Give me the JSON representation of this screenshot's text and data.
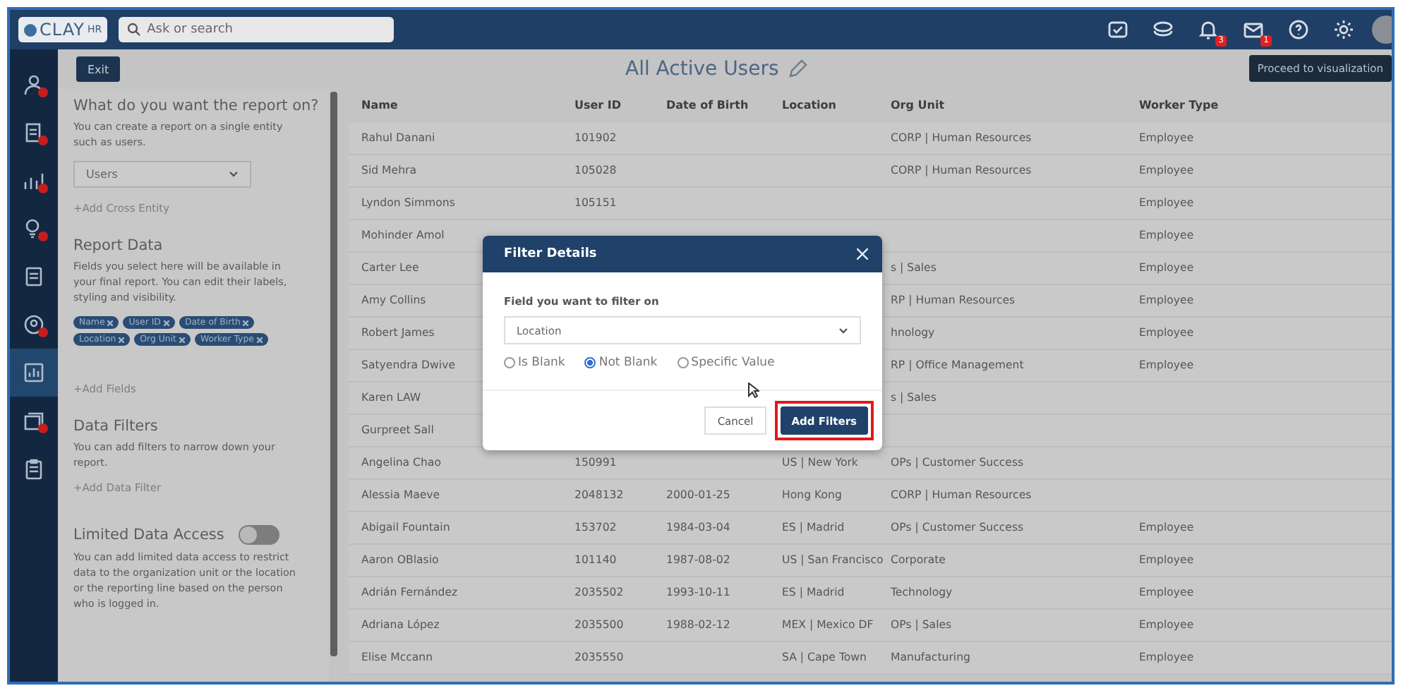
{
  "topbar": {
    "logo": {
      "name": "CLAY",
      "suffix": "HR"
    },
    "search": {
      "placeholder": "Ask or search"
    },
    "notifications_badge": "3",
    "messages_badge": "1"
  },
  "sidebar": {
    "items": [
      {
        "selected": false,
        "alert": true
      },
      {
        "selected": false,
        "alert": true
      },
      {
        "selected": false,
        "alert": true
      },
      {
        "selected": false,
        "alert": true
      },
      {
        "selected": false,
        "alert": false
      },
      {
        "selected": false,
        "alert": true
      },
      {
        "selected": true,
        "alert": false
      },
      {
        "selected": false,
        "alert": true
      },
      {
        "selected": false,
        "alert": false
      }
    ]
  },
  "toolbar": {
    "exit_button": "Exit",
    "title": "All Active Users",
    "tooltip": "Proceed to visualization"
  },
  "report_panel": {
    "entity": {
      "heading": "What do you want the report on?",
      "description": "You can create a report on a single entity such as users.",
      "select_value": "Users",
      "link": "+Add Cross Entity"
    },
    "report_data": {
      "heading": "Report Data",
      "description": "Fields you select here will be available in your final report. You can edit their labels, styling and visibility.",
      "chips": [
        "Name",
        "User ID",
        "Date of Birth",
        "Location",
        "Org Unit",
        "Worker Type"
      ],
      "link": "+Add Fields"
    },
    "data_filters": {
      "heading": "Data Filters",
      "description": "You can add filters to narrow down your report.",
      "link": "+Add Data Filter"
    },
    "limited_access": {
      "heading": "Limited Data Access",
      "on": false,
      "description": "You can add limited data access to restrict data to the organization unit or the location or the reporting line based on the person who is logged in."
    }
  },
  "table": {
    "columns": [
      "Name",
      "User ID",
      "Date of Birth",
      "Location",
      "Org Unit",
      "Worker Type"
    ],
    "rows": [
      {
        "cells": [
          "Rahul Danani",
          "101902",
          null,
          null,
          "CORP | Human Resources",
          "Employee"
        ]
      },
      {
        "cells": [
          "Sid Mehra",
          "105028",
          null,
          null,
          "CORP | Human Resources",
          "Employee"
        ]
      },
      {
        "cells": [
          "Lyndon Simmons",
          "105151",
          null,
          null,
          null,
          "Employee"
        ]
      },
      {
        "cells": [
          "Mohinder Amol",
          null,
          null,
          null,
          null,
          "Employee"
        ]
      },
      {
        "cells": [
          "Carter Lee",
          null,
          null,
          null,
          "s | Sales",
          "Employee"
        ]
      },
      {
        "cells": [
          "Amy Collins",
          null,
          null,
          null,
          "RP | Human Resources",
          "Employee"
        ]
      },
      {
        "cells": [
          "Robert James",
          null,
          null,
          null,
          "hnology",
          "Employee"
        ]
      },
      {
        "cells": [
          "Satyendra Dwive",
          null,
          null,
          null,
          "RP | Office Management",
          "Employee"
        ]
      },
      {
        "cells": [
          "Karen LAW",
          null,
          null,
          null,
          "s | Sales",
          null
        ]
      },
      {
        "cells": [
          "Gurpreet Sall",
          null,
          null,
          null,
          null,
          null
        ]
      },
      {
        "cells": [
          "Angelina Chao",
          "150991",
          null,
          "US | New York",
          "OPs | Customer Success",
          null
        ]
      },
      {
        "cells": [
          "Alessia Maeve",
          "2048132",
          "2000-01-25",
          "Hong Kong",
          "CORP | Human Resources",
          null
        ]
      },
      {
        "cells": [
          "Abigail Fountain",
          "153702",
          "1984-03-04",
          "ES | Madrid",
          "OPs | Customer Success",
          "Employee"
        ]
      },
      {
        "cells": [
          "Aaron OBlasio",
          "101140",
          "1987-08-02",
          "US | San Francisco",
          "Corporate",
          "Employee"
        ]
      },
      {
        "cells": [
          "Adrián Fernández",
          "2035502",
          "1993-10-11",
          "ES | Madrid",
          "Technology",
          "Employee"
        ]
      },
      {
        "cells": [
          "Adriana López",
          "2035500",
          "1988-02-12",
          "MEX | Mexico DF",
          "OPs | Sales",
          "Employee"
        ]
      },
      {
        "cells": [
          "Elise Mccann",
          "2035550",
          null,
          "SA | Cape Town",
          "Manufacturing",
          "Employee"
        ]
      }
    ]
  },
  "modal": {
    "title": "Filter Details",
    "field_label": "Field you want to filter on",
    "field_value": "Location",
    "options": [
      {
        "label": "Is Blank",
        "selected": false
      },
      {
        "label": "Not Blank",
        "selected": true
      },
      {
        "label": "Specific Value",
        "selected": false
      }
    ],
    "cancel_button": "Cancel",
    "submit_button": "Add Filters",
    "submit_highlighted": true
  }
}
